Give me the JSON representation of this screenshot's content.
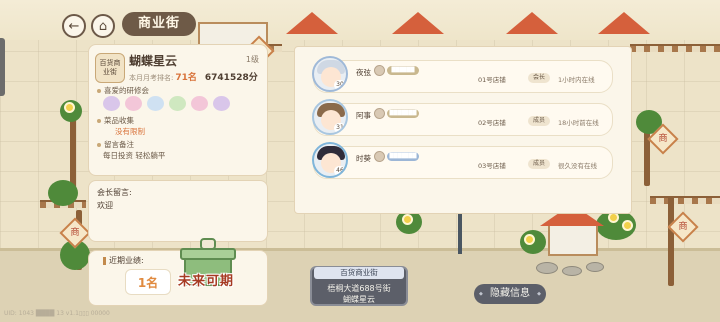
{
  "header": {
    "title": "商业街",
    "back_icon": "back-arrow-icon",
    "home_icon": "home-icon"
  },
  "shop": {
    "badge": "百货商业街",
    "name": "蝴蝶星云",
    "level": "1级",
    "rank_label": "本月月考排名:",
    "rank": "71名",
    "funds": "6741528分",
    "favorite_title": "喜爱的研修会",
    "favorite_colors": [
      "#d9c6ea",
      "#f3c6d8",
      "#cfe1f2",
      "#cfe8c0",
      "#f3c6d8",
      "#d9c6ea"
    ],
    "collection_title": "菜品收集",
    "collection_value": "没有限制",
    "note_title": "留言备注",
    "note_value": "每日投资 轻松躺平"
  },
  "message": {
    "label": "会长留言:",
    "text": "欢迎"
  },
  "performance": {
    "label": "近期业绩:",
    "value": "1名",
    "coming_soon": "未来可期"
  },
  "members": [
    {
      "name": "夜弦",
      "level": "30",
      "tag": "██████",
      "shop": "01号店铺",
      "role": "会长",
      "online": "1小时内在线",
      "hair": "#cfd8e4",
      "border": "#9fb9d8",
      "tagcolor": "#c9b88f"
    },
    {
      "name": "阿事",
      "level": "31",
      "tag": "███████",
      "shop": "02号店铺",
      "role": "成员",
      "online": "18小时前在线",
      "hair": "#8a6a4b",
      "border": "#a8c6e0",
      "tagcolor": "#c9b88f"
    },
    {
      "name": "时葵",
      "level": "46",
      "tag": "███████",
      "shop": "03号店铺",
      "role": "成员",
      "online": "很久没有在线",
      "hair": "#2f2c3a",
      "border": "#7fb5da",
      "tagcolor": "#9cb6d6"
    }
  ],
  "address": {
    "category": "百货商业街",
    "street": "梧桐大道688号街",
    "shop": "蝴蝶星云"
  },
  "hide_button": "隐藏信息",
  "uid": "UID: 1043 ████ 13 v1.1▯▯▯ 00000"
}
